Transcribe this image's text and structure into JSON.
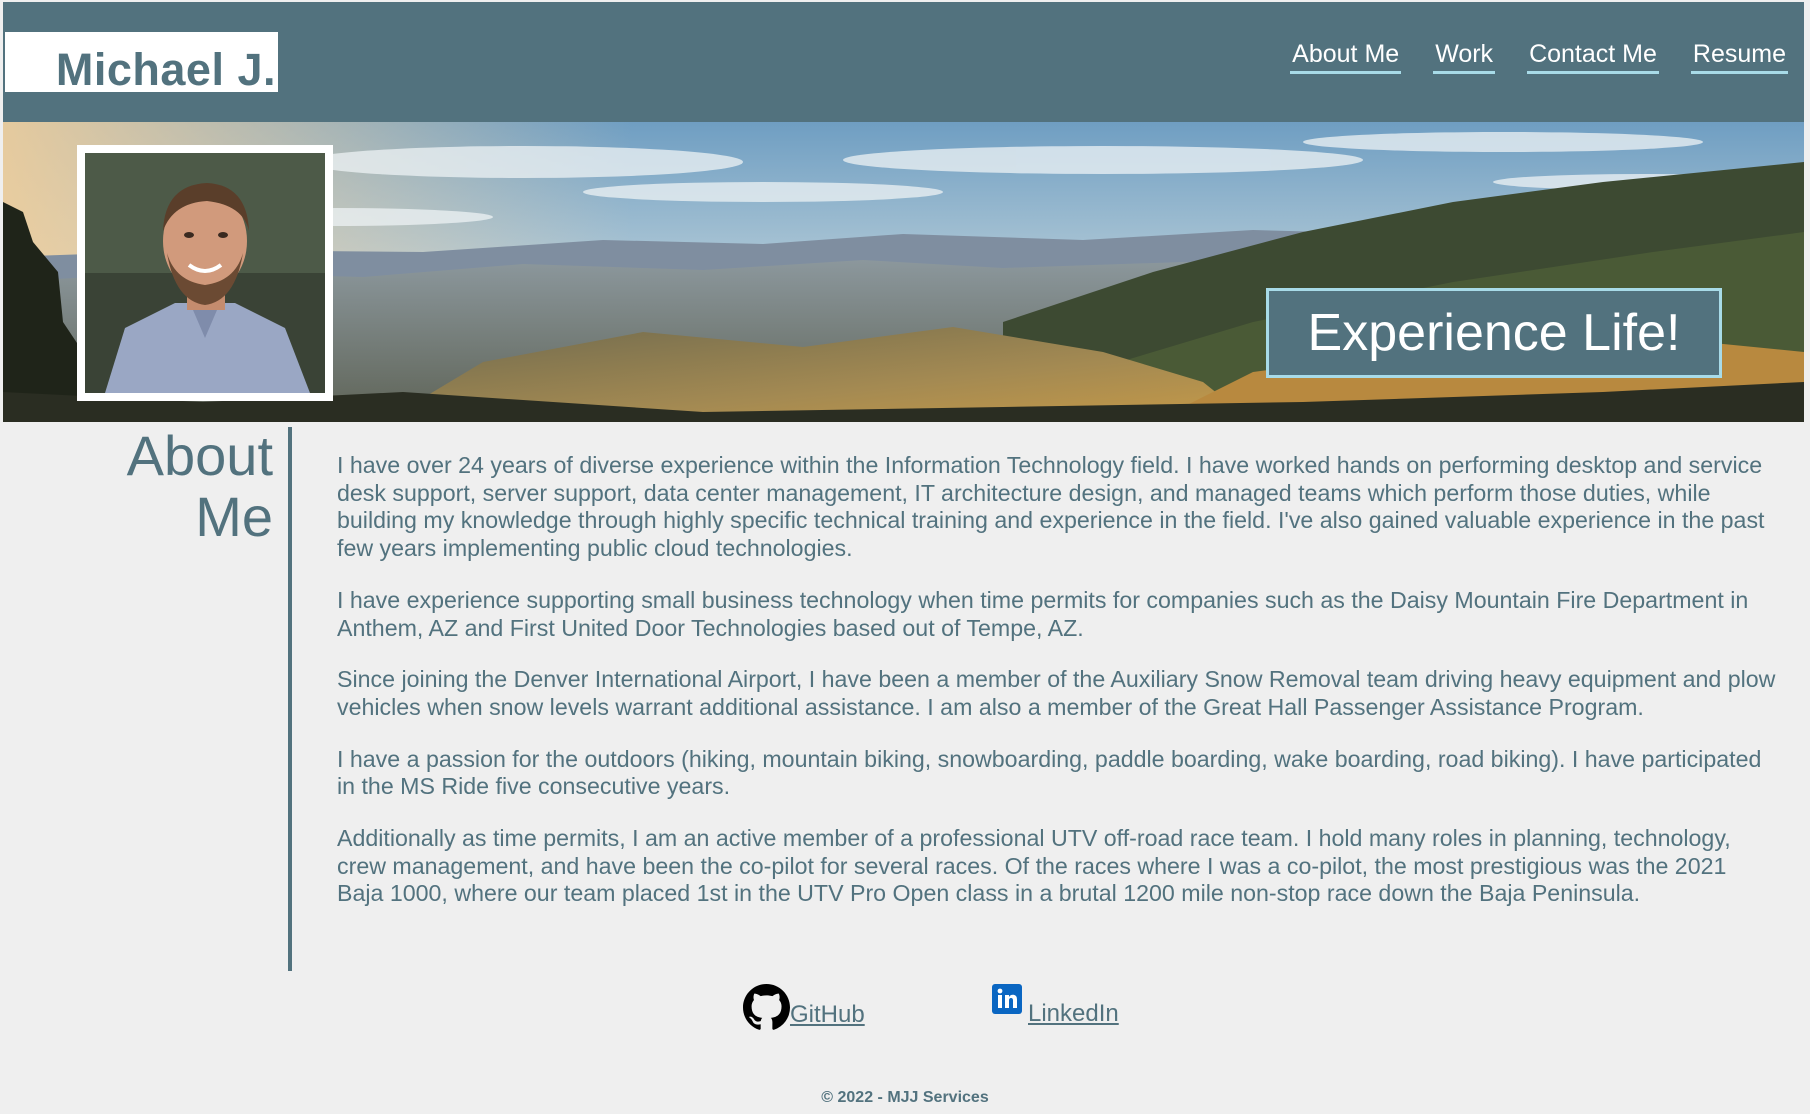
{
  "header": {
    "logo_text": "Michael J.",
    "nav": [
      {
        "label": "About Me"
      },
      {
        "label": "Work"
      },
      {
        "label": "Contact Me"
      },
      {
        "label": "Resume"
      }
    ]
  },
  "hero": {
    "tagline": "Experience Life!"
  },
  "about": {
    "title_line1": "About",
    "title_line2": "Me",
    "paragraphs": [
      "I have over 24 years of diverse experience within the Information Technology field. I have worked hands on performing desktop and service desk support, server support, data center management, IT architecture design, and managed teams which perform those duties, while building my knowledge through highly specific technical training and experience in the field. I've also gained valuable experience in the past few years implementing public cloud technologies.",
      "I have experience supporting small business technology when time permits for companies such as the Daisy Mountain Fire Department in Anthem, AZ and First United Door Technologies based out of Tempe, AZ.",
      "Since joining the Denver International Airport, I have been a member of the Auxiliary Snow Removal team driving heavy equipment and plow vehicles when snow levels warrant additional assistance. I am also a member of the Great Hall Passenger Assistance Program.",
      "I have a passion for the outdoors (hiking, mountain biking, snowboarding, paddle boarding, wake boarding, road biking). I have participated in the MS Ride five consecutive years.",
      "Additionally as time permits, I am an active member of a professional UTV off-road race team. I hold many roles in planning, technology, crew management, and have been the co-pilot for several races. Of the races where I was a co-pilot, the most prestigious was the 2021 Baja 1000, where our team placed 1st in the UTV Pro Open class in a brutal 1200 mile non-stop race down the Baja Peninsula."
    ]
  },
  "social": {
    "github_label": "GitHub",
    "github_icon": "github-icon",
    "linkedin_label": "LinkedIn",
    "linkedin_icon": "linkedin-icon"
  },
  "footer": {
    "copyright": "© 2022 - MJJ Services"
  },
  "colors": {
    "primary": "#52727e",
    "accent": "#a8dbe8",
    "background": "#efefef"
  }
}
